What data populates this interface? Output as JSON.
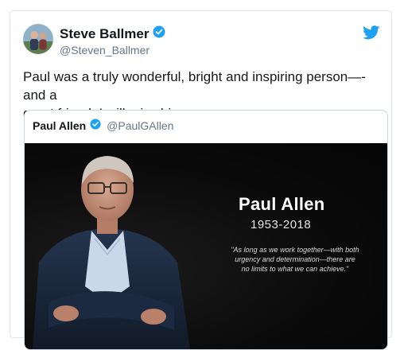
{
  "tweet": {
    "author_name": "Steve Ballmer",
    "author_handle": "@Steven_Ballmer",
    "text_line1": "Paul was a truly wonderful, bright and inspiring person—- and a",
    "text_line2": "great friend. I will miss him"
  },
  "quoted_tweet": {
    "author_name": "Paul Allen",
    "author_handle": "@PaulGAllen"
  },
  "media": {
    "name": "Paul Allen",
    "years": "1953-2018",
    "quote_line1": "\"As long as we work together—with both",
    "quote_line2": "urgency and determination—there are",
    "quote_line3": "no limits to what we can achieve.\""
  },
  "colors": {
    "verified_blue": "#1da1f2",
    "twitter_blue": "#1da1f2",
    "text_primary": "#14171a",
    "text_secondary": "#657786"
  },
  "icons": [
    "verified-icon",
    "twitter-bird-icon"
  ]
}
